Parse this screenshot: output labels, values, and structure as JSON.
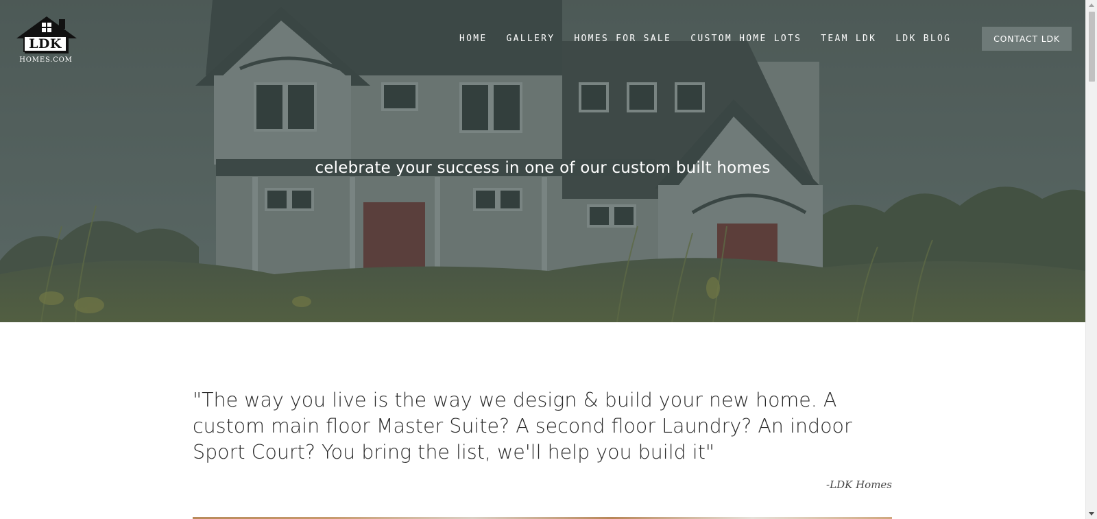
{
  "brand": {
    "logo_word": "LDK",
    "logo_sub": "HOMES.COM"
  },
  "nav": {
    "items": [
      {
        "label": "HOME"
      },
      {
        "label": "GALLERY"
      },
      {
        "label": "HOMES FOR SALE"
      },
      {
        "label": "CUSTOM HOME LOTS"
      },
      {
        "label": "TEAM LDK"
      },
      {
        "label": "LDK BLOG"
      }
    ],
    "contact_label": "CONTACT LDK"
  },
  "hero": {
    "tagline": "celebrate your success in one of our custom built homes",
    "overlay_color": "#5d6a68"
  },
  "quote": {
    "text": "\"The way you live is the way we design & build your new home. A custom main floor Master Suite? A second floor Laundry? An indoor Sport Court? You bring the list, we'll help you build it\"",
    "author": "-LDK Homes"
  },
  "icons": {
    "logo": "house-logo-icon",
    "scroll_up": "chevron-up-icon",
    "scroll_down": "chevron-down-icon"
  }
}
